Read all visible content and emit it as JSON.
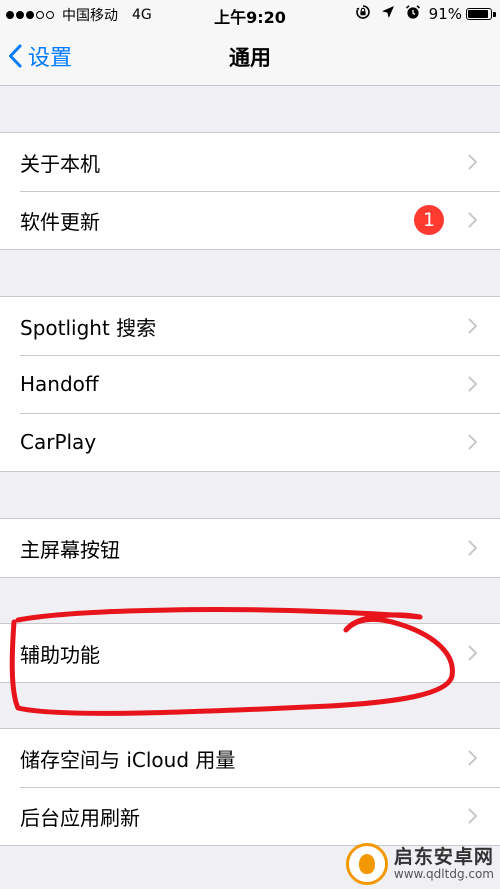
{
  "status_bar": {
    "carrier": "中国移动",
    "network": "4G",
    "time": "上午9:20",
    "battery_percent": "91%",
    "battery_level": 0.91,
    "icons": [
      "orientation-lock-icon",
      "location-arrow-icon",
      "alarm-icon",
      "battery-icon"
    ]
  },
  "nav": {
    "back_label": "设置",
    "title": "通用"
  },
  "groups": [
    {
      "rows": [
        {
          "label": "关于本机"
        },
        {
          "label": "软件更新",
          "badge": "1"
        }
      ]
    },
    {
      "rows": [
        {
          "label": "Spotlight 搜索"
        },
        {
          "label": "Handoff"
        },
        {
          "label": "CarPlay"
        }
      ]
    },
    {
      "rows": [
        {
          "label": "主屏幕按钮"
        }
      ]
    },
    {
      "rows": [
        {
          "label": "辅助功能"
        }
      ]
    },
    {
      "rows": [
        {
          "label": "储存空间与 iCloud 用量"
        },
        {
          "label": "后台应用刷新"
        }
      ]
    }
  ],
  "watermark": {
    "title": "启东安卓网",
    "url": "www.qdltdg.com"
  },
  "colors": {
    "accent": "#007aff",
    "badge": "#ff3b30",
    "annotation": "#e8141b",
    "background": "#efeff4"
  }
}
